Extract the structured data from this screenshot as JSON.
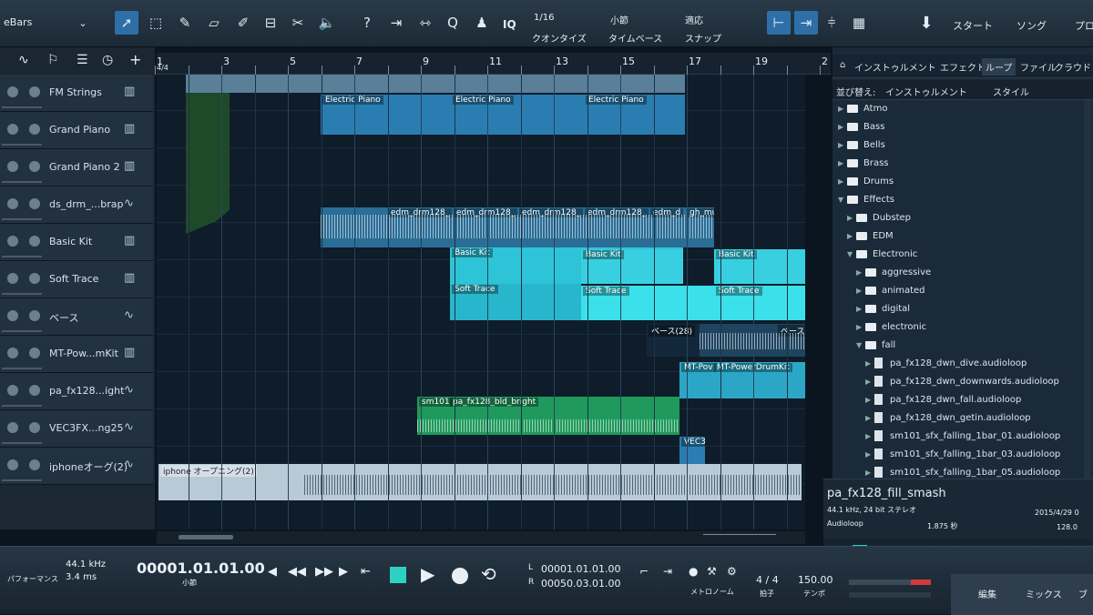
{
  "toolbar": {
    "song_title": "eBars",
    "quantize_value": "1/16",
    "quantize_label": "クオンタイズ",
    "timebase_value": "小節",
    "timebase_label": "タイムベース",
    "snap_value": "適応",
    "snap_label": "スナップ",
    "iq_label": "IQ",
    "start_label": "スタート",
    "song_label": "ソング",
    "project_label": "プロ"
  },
  "ruler": {
    "marks": [
      "1",
      "3",
      "5",
      "7",
      "9",
      "11",
      "13",
      "15",
      "17",
      "19",
      "2"
    ],
    "time_sig": "4/4"
  },
  "tracks": [
    {
      "name": "FM Strings",
      "icon": "piano-icon"
    },
    {
      "name": "Grand Piano",
      "icon": "piano-icon"
    },
    {
      "name": "Grand Piano 2",
      "icon": "piano-icon"
    },
    {
      "name": "ds_drm_...brap",
      "icon": "wave-icon"
    },
    {
      "name": "Basic Kit",
      "icon": "piano-icon"
    },
    {
      "name": "Soft Trace",
      "icon": "piano-icon"
    },
    {
      "name": "ベース",
      "icon": "wave-icon"
    },
    {
      "name": "MT-Pow...mKit",
      "icon": "piano-icon"
    },
    {
      "name": "pa_fx128...ight",
      "icon": "wave-icon"
    },
    {
      "name": "VEC3FX...ng25",
      "icon": "wave-icon"
    },
    {
      "name": "iphoneオーグ(2)",
      "icon": "wave-icon"
    }
  ],
  "clips": {
    "ep1": "Electric Piano",
    "ep2": "Electric Piano",
    "ep3": "Electric Piano",
    "drm1": "edm_drm128_",
    "drm2": "edm_drm128_",
    "drm3": "edm_drm128_",
    "drm4": "edm_drm128_",
    "drm5": "edm_d",
    "drm6": "gh_mu",
    "bk1": "Basic Kit",
    "bk2": "Basic Kit",
    "bk3": "Basic Kit",
    "st1": "Soft Trace",
    "st2": "Soft Trace",
    "st3": "Soft Trace",
    "bass1": "ベース(28)",
    "bass2": "ベース",
    "mt1": "MT-Pov",
    "mt2": "MT-PowerDrumKit",
    "fx1": "sm101",
    "fx2": "pa_fx128_bld_bright",
    "vec": "VEC3",
    "iphone": "iphone オープニング(2)"
  },
  "browser": {
    "tabs": [
      "インストゥルメント",
      "エフェクト",
      "ループ",
      "ファイル",
      "クラウド"
    ],
    "sort_label": "並び替え:",
    "sort_value": "インストゥルメント",
    "style_label": "スタイル",
    "folders": [
      {
        "name": "Atmo",
        "level": 0,
        "open": false
      },
      {
        "name": "Bass",
        "level": 0,
        "open": false
      },
      {
        "name": "Bells",
        "level": 0,
        "open": false
      },
      {
        "name": "Brass",
        "level": 0,
        "open": false
      },
      {
        "name": "Drums",
        "level": 0,
        "open": false
      },
      {
        "name": "Effects",
        "level": 0,
        "open": true
      },
      {
        "name": "Dubstep",
        "level": 1,
        "open": false
      },
      {
        "name": "EDM",
        "level": 1,
        "open": false
      },
      {
        "name": "Electronic",
        "level": 1,
        "open": true
      },
      {
        "name": "aggressive",
        "level": 2,
        "open": false
      },
      {
        "name": "animated",
        "level": 2,
        "open": false
      },
      {
        "name": "digital",
        "level": 2,
        "open": false
      },
      {
        "name": "electronic",
        "level": 2,
        "open": false
      },
      {
        "name": "fall",
        "level": 2,
        "open": true
      }
    ],
    "files": [
      "pa_fx128_dwn_dive.audioloop",
      "pa_fx128_dwn_downwards.audioloop",
      "pa_fx128_dwn_fall.audioloop",
      "pa_fx128_dwn_getin.audioloop",
      "sm101_sfx_falling_1bar_01.audioloop",
      "sm101_sfx_falling_1bar_03.audioloop",
      "sm101_sfx_falling_1bar_05.audioloop"
    ],
    "info_title": "pa_fx128_fill_smash",
    "info_format": "44.1 kHz, 24 bit ステレオ",
    "info_date": "2015/4/29 0",
    "info_type": "Audioloop",
    "info_size": "1.875 秒",
    "info_bpm": "128.0"
  },
  "transport": {
    "sample_rate": "44.1 kHz",
    "latency": "3.4 ms",
    "perf_label": "パフォーマンス",
    "position": "00001.01.01.00",
    "position_unit": "小節",
    "loop_l": "00001.01.01.00",
    "loop_r": "00050.03.01.00",
    "l_label": "L",
    "r_label": "R",
    "metronome_label": "メトロノーム",
    "time_sig": "4 / 4",
    "time_sig_label": "拍子",
    "tempo": "150.00",
    "tempo_label": "テンポ",
    "edit_label": "編集",
    "mix_label": "ミックス",
    "browse_label": "ブ"
  }
}
